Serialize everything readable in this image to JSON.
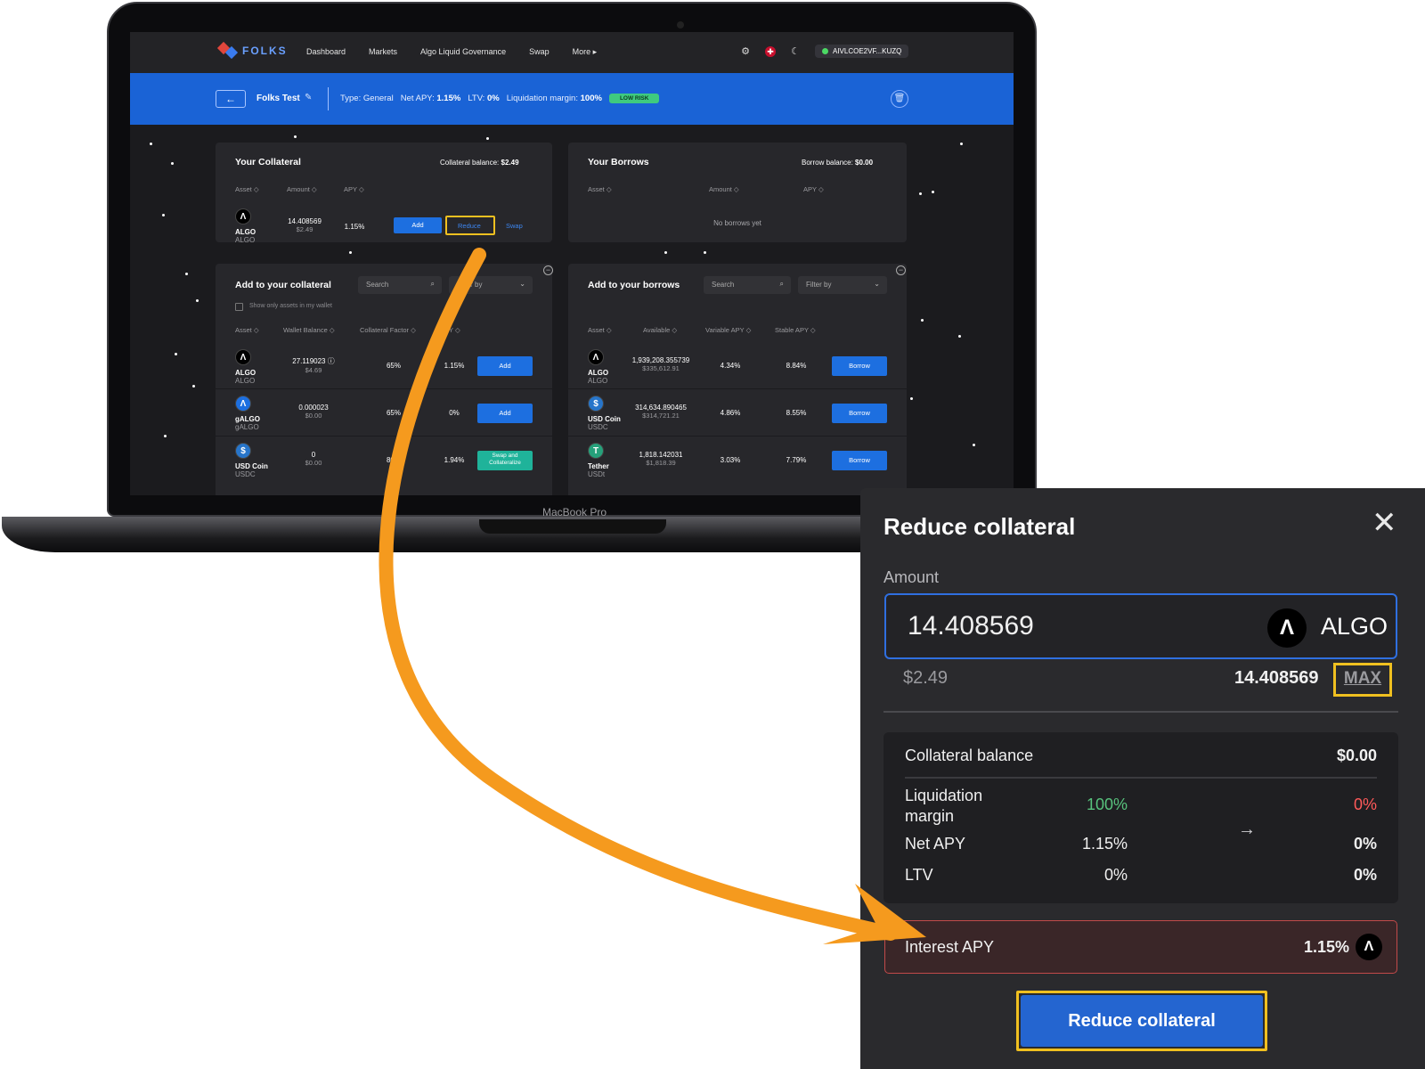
{
  "nav": {
    "brand": "FOLKS",
    "links": [
      "Dashboard",
      "Markets",
      "Algo Liquid Governance",
      "Swap",
      "More ▸"
    ],
    "wallet": "AIVLCOE2VF...KUZQ"
  },
  "account_bar": {
    "name": "Folks Test",
    "type_label": "Type:",
    "type_value": "General",
    "net_apy_label": "Net APY:",
    "net_apy": "1.15%",
    "ltv_label": "LTV:",
    "ltv": "0%",
    "liq_label": "Liquidation margin:",
    "liq": "100%",
    "risk": "LOW RISK"
  },
  "collateral": {
    "title": "Your Collateral",
    "balance_label": "Collateral balance:",
    "balance": "$2.49",
    "headers": [
      "Asset ◇",
      "Amount ◇",
      "APY ◇"
    ],
    "row": {
      "symbol": "ALGO",
      "sub": "ALGO",
      "amount": "14.408569",
      "amount_usd": "$2.49",
      "apy": "1.15%"
    },
    "add_label": "Add",
    "reduce_label": "Reduce",
    "swap_label": "Swap"
  },
  "borrows": {
    "title": "Your Borrows",
    "balance_label": "Borrow balance:",
    "balance": "$0.00",
    "headers": [
      "Asset ◇",
      "Amount ◇",
      "APY ◇"
    ],
    "empty": "No borrows yet"
  },
  "add_collateral": {
    "title": "Add to your collateral",
    "search_placeholder": "Search",
    "filter_placeholder": "Filter by",
    "only_wallet": "Show only assets in my wallet",
    "headers": [
      "Asset ◇",
      "Wallet Balance ◇",
      "Collateral Factor ◇",
      "APY ◇"
    ],
    "rows": [
      {
        "symbol": "ALGO",
        "sub": "ALGO",
        "balance": "27.119023 ⓘ",
        "balance_usd": "$4.69",
        "factor": "65%",
        "apy": "1.15%",
        "action": "Add"
      },
      {
        "symbol": "gALGO",
        "sub": "gALGO",
        "balance": "0.000023",
        "balance_usd": "$0.00",
        "factor": "65%",
        "apy": "0%",
        "action": "Add"
      },
      {
        "symbol": "USD Coin",
        "sub": "USDC",
        "balance": "0",
        "balance_usd": "$0.00",
        "factor": "80%",
        "apy": "1.94%",
        "action": "Swap and Collateralize"
      }
    ]
  },
  "add_borrows": {
    "title": "Add to your borrows",
    "search_placeholder": "Search",
    "filter_placeholder": "Filter by",
    "headers": [
      "Asset ◇",
      "Available ◇",
      "Variable APY ◇",
      "Stable APY ◇"
    ],
    "rows": [
      {
        "symbol": "ALGO",
        "sub": "ALGO",
        "available": "1,939,208.355739",
        "available_usd": "$335,612.91",
        "variable": "4.34%",
        "stable": "8.84%",
        "action": "Borrow"
      },
      {
        "symbol": "USD Coin",
        "sub": "USDC",
        "available": "314,634.890465",
        "available_usd": "$314,721.21",
        "variable": "4.86%",
        "stable": "8.55%",
        "action": "Borrow"
      },
      {
        "symbol": "Tether",
        "sub": "USDt",
        "available": "1,818.142031",
        "available_usd": "$1,818.39",
        "variable": "3.03%",
        "stable": "7.79%",
        "action": "Borrow"
      }
    ]
  },
  "laptop_brand": "MacBook Pro",
  "modal": {
    "title": "Reduce collateral",
    "amount_label": "Amount",
    "amount_value": "14.408569",
    "asset": "ALGO",
    "usd_value": "$2.49",
    "balance": "14.408569",
    "max_label": "MAX",
    "collateral_balance_label": "Collateral balance",
    "collateral_balance": "$0.00",
    "liq_label": "Liquidation margin",
    "liq_from": "100%",
    "liq_to": "0%",
    "net_apy_label": "Net APY",
    "net_apy_from": "1.15%",
    "net_apy_to": "0%",
    "ltv_label": "LTV",
    "ltv_from": "0%",
    "ltv_to": "0%",
    "interest_label": "Interest APY",
    "interest_value": "1.15%",
    "submit_label": "Reduce collateral"
  },
  "colors": {
    "accent_blue": "#1a63d6",
    "highlight": "#f0c020",
    "arrow": "#f59a1e",
    "positive": "#58c27d",
    "negative": "#ff5a5a"
  }
}
